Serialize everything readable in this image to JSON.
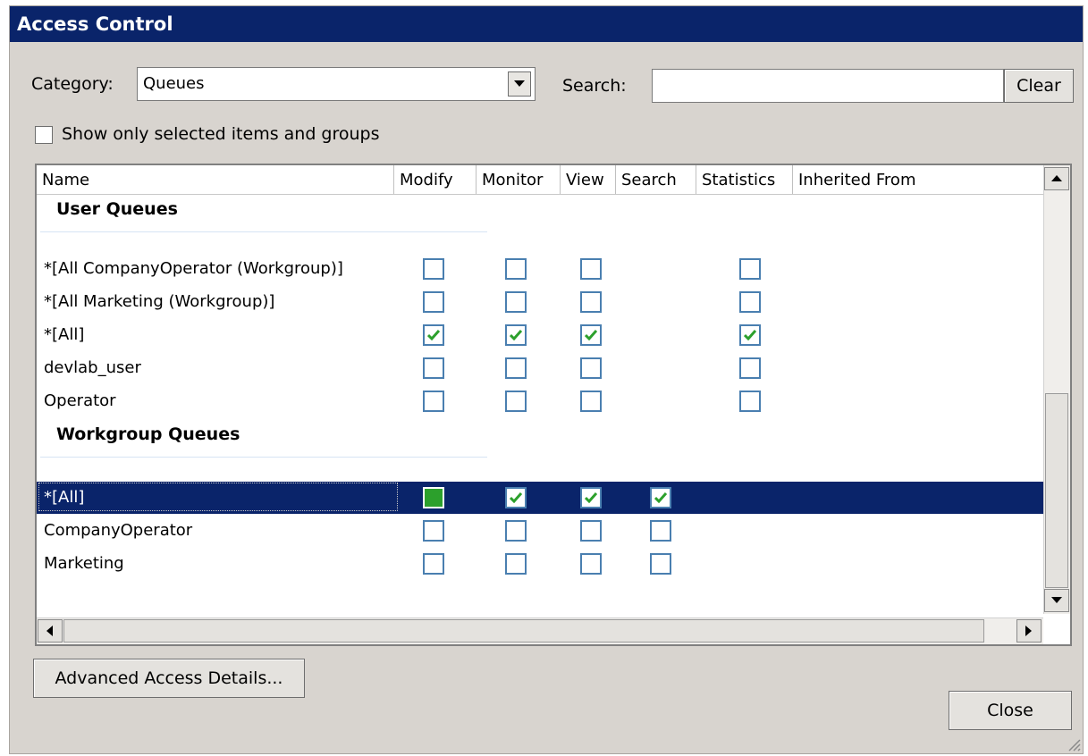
{
  "window": {
    "title": "Access Control"
  },
  "filters": {
    "category_label": "Category:",
    "category_value": "Queues",
    "search_label": "Search:",
    "search_value": "",
    "clear_label": "Clear",
    "show_selected_label": "Show only selected items and groups",
    "show_selected_checked": false
  },
  "table": {
    "columns": [
      "Name",
      "Modify",
      "Monitor",
      "View",
      "Search",
      "Statistics",
      "Inherited From"
    ],
    "groups": [
      {
        "title": "User Queues",
        "rows": [
          {
            "name": "*[All CompanyOperator (Workgroup)]",
            "modify": "unchecked",
            "monitor": "unchecked",
            "view": "unchecked",
            "search": "none",
            "statistics": "unchecked"
          },
          {
            "name": "*[All Marketing (Workgroup)]",
            "modify": "unchecked",
            "monitor": "unchecked",
            "view": "unchecked",
            "search": "none",
            "statistics": "unchecked"
          },
          {
            "name": "*[All]",
            "modify": "checked",
            "monitor": "checked",
            "view": "checked",
            "search": "none",
            "statistics": "checked"
          },
          {
            "name": "devlab_user",
            "modify": "unchecked",
            "monitor": "unchecked",
            "view": "unchecked",
            "search": "none",
            "statistics": "unchecked"
          },
          {
            "name": "Operator",
            "modify": "unchecked",
            "monitor": "unchecked",
            "view": "unchecked",
            "search": "none",
            "statistics": "unchecked"
          }
        ]
      },
      {
        "title": "Workgroup Queues",
        "rows": [
          {
            "name": "*[All]",
            "selected": true,
            "modify": "filled",
            "monitor": "checked",
            "view": "checked",
            "search": "checked",
            "statistics": "none"
          },
          {
            "name": "CompanyOperator",
            "modify": "unchecked",
            "monitor": "unchecked",
            "view": "unchecked",
            "search": "unchecked",
            "statistics": "none"
          },
          {
            "name": "Marketing",
            "modify": "unchecked",
            "monitor": "unchecked",
            "view": "unchecked",
            "search": "unchecked",
            "statistics": "none"
          }
        ]
      }
    ]
  },
  "footer": {
    "advanced_label": "Advanced Access Details...",
    "close_label": "Close"
  },
  "colors": {
    "titlebar": "#0a246a",
    "selection": "#0a246a",
    "check_green": "#2ca02c",
    "checkbox_border": "#4a7fb0"
  },
  "icons": [
    "dropdown-arrow-icon",
    "scroll-up-icon",
    "scroll-down-icon",
    "scroll-left-icon",
    "scroll-right-icon",
    "checkmark-icon",
    "resize-grip-icon"
  ]
}
